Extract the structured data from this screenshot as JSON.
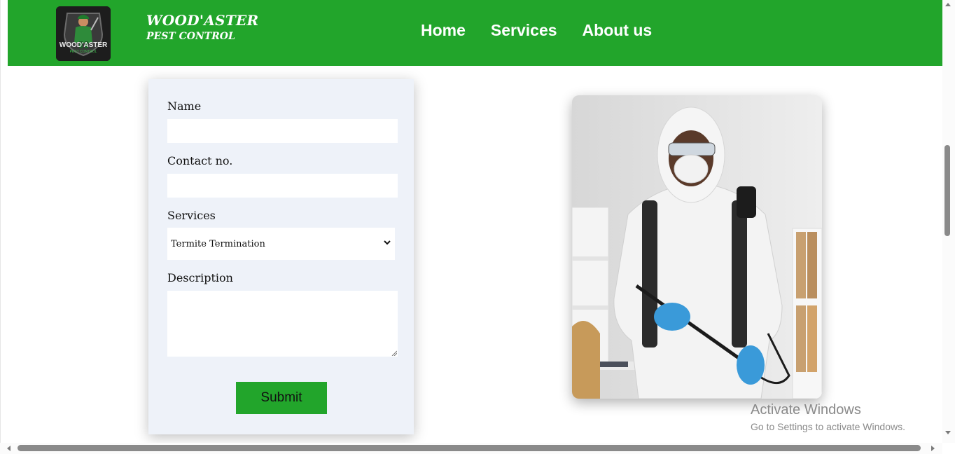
{
  "brand": {
    "name": "WOOD'ASTER",
    "tagline": "PEST CONTROL",
    "logo_text": "WOOD'ASTER",
    "logo_subtext": "PEST CONTROL",
    "color": "#22a52b"
  },
  "nav": {
    "items": [
      {
        "label": "Home"
      },
      {
        "label": "Services"
      },
      {
        "label": "About us"
      }
    ]
  },
  "form": {
    "name_label": "Name",
    "name_value": "",
    "contact_label": "Contact no.",
    "contact_value": "",
    "services_label": "Services",
    "services_selected": "Termite Termination",
    "description_label": "Description",
    "description_value": "",
    "submit_label": "Submit"
  },
  "watermark": {
    "title": "Activate Windows",
    "subtitle": "Go to Settings to activate Windows."
  },
  "icons": {
    "select": "chevron-down-icon",
    "resize": "resize-grip-icon"
  }
}
